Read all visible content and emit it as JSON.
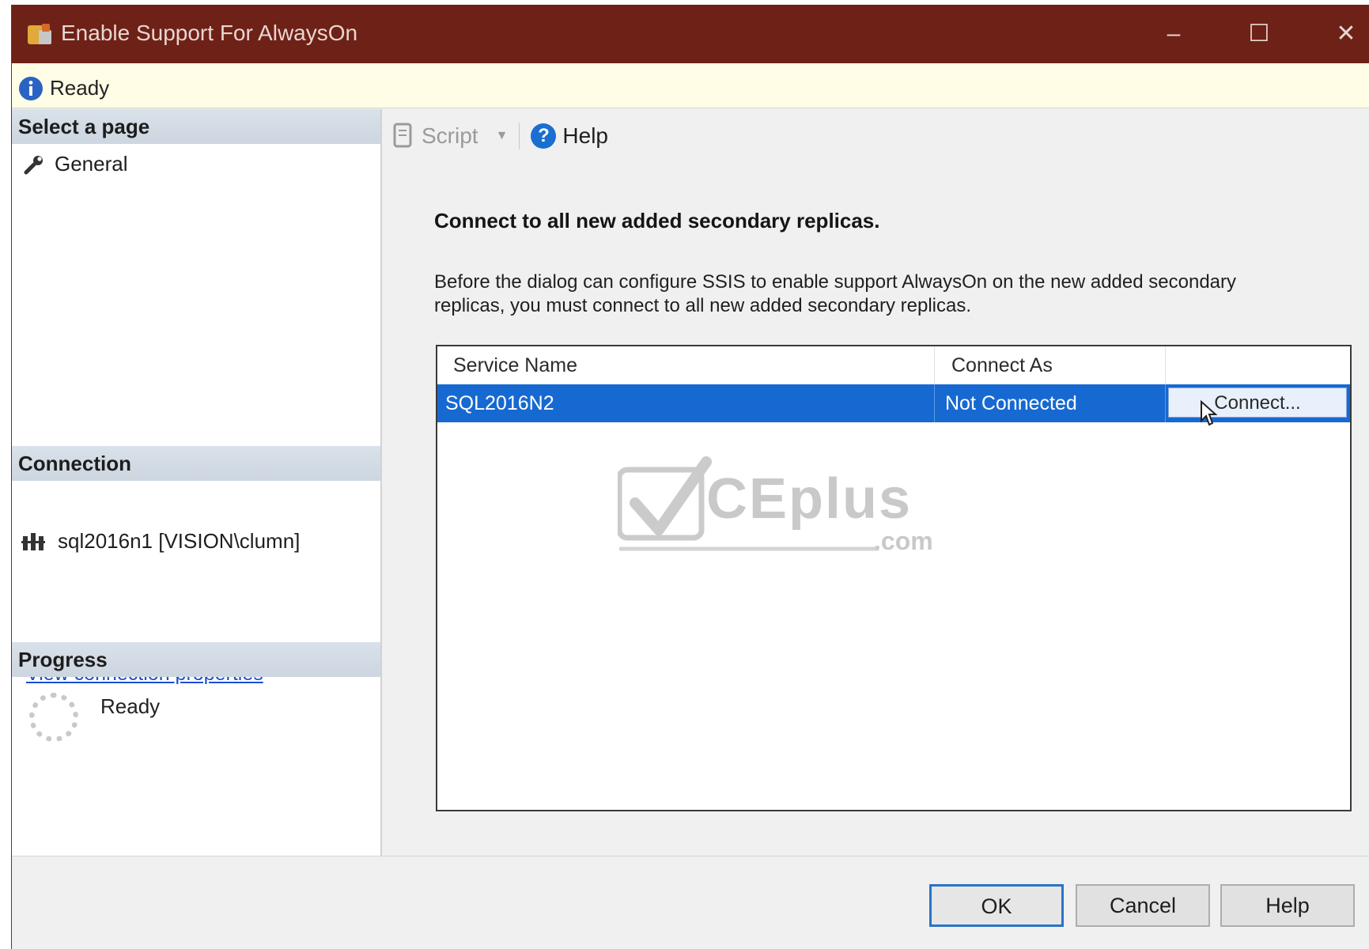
{
  "window": {
    "title": "Enable Support For AlwaysOn",
    "minimize_glyph": "–",
    "maximize_glyph": "☐",
    "close_glyph": "✕"
  },
  "infobar": {
    "icon": "info-icon",
    "text": "Ready"
  },
  "left_panel": {
    "select_page_header": "Select a page",
    "pages": [
      {
        "label": "General",
        "icon": "wrench-icon"
      }
    ],
    "connection_header": "Connection",
    "connection_text": "sql2016n1 [VISION\\clumn]",
    "view_connection_link": "View connection properties",
    "progress_header": "Progress",
    "progress_status": "Ready"
  },
  "toolbar": {
    "script_label": "Script",
    "help_label": "Help"
  },
  "main": {
    "heading": "Connect to all new added secondary replicas.",
    "description": "Before the dialog can configure SSIS to enable support AlwaysOn on the new added secondary replicas, you must connect to all new added secondary replicas.",
    "grid": {
      "columns": [
        "Service Name",
        "Connect As",
        ""
      ],
      "rows": [
        {
          "service_name": "SQL2016N2",
          "connect_as": "Not Connected",
          "action_label": "Connect...",
          "selected": true
        }
      ]
    }
  },
  "watermark": {
    "text_main": "CEplus",
    "text_domain": ".com"
  },
  "buttons": {
    "ok": "OK",
    "cancel": "Cancel",
    "help": "Help"
  },
  "colors": {
    "titlebar": "#6e2116",
    "selection": "#1769d2",
    "link": "#1a4fcf",
    "infobar": "#fffde5"
  }
}
